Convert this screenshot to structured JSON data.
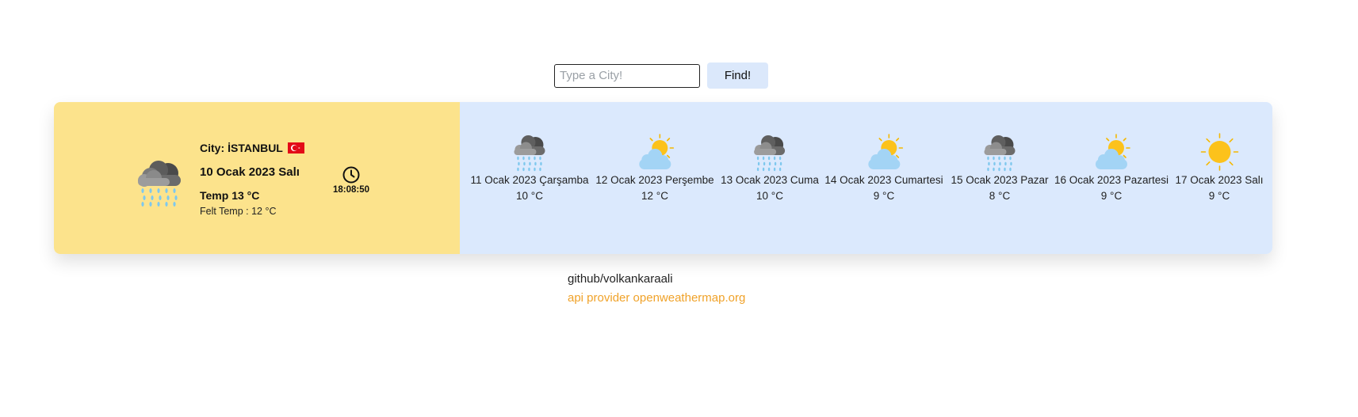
{
  "search": {
    "placeholder": "Type a City!",
    "value": "",
    "button_label": "Find!"
  },
  "current": {
    "city_prefix": "City: ",
    "city": "İSTANBUL",
    "flag": "turkey-flag",
    "date": "10 Ocak 2023 Salı",
    "temp": "Temp 13 °C",
    "felt_temp": "Felt Temp : 12 °C",
    "time": "18:08:50",
    "icon": "rain-cloud-icon"
  },
  "forecast": [
    {
      "date": "11 Ocak 2023 Çarşamba",
      "temp": "10 °C",
      "icon": "rain-cloud-icon"
    },
    {
      "date": "12 Ocak 2023 Perşembe",
      "temp": "12 °C",
      "icon": "partly-cloudy-icon"
    },
    {
      "date": "13 Ocak 2023 Cuma",
      "temp": "10 °C",
      "icon": "rain-cloud-icon"
    },
    {
      "date": "14 Ocak 2023 Cumartesi",
      "temp": "9 °C",
      "icon": "partly-cloudy-icon"
    },
    {
      "date": "15 Ocak 2023 Pazar",
      "temp": "8 °C",
      "icon": "rain-cloud-icon"
    },
    {
      "date": "16 Ocak 2023 Pazartesi",
      "temp": "9 °C",
      "icon": "partly-cloudy-icon"
    },
    {
      "date": "17 Ocak 2023 Salı",
      "temp": "9 °C",
      "icon": "sun-icon"
    }
  ],
  "footer": {
    "github": "github/volkankaraali",
    "api": "api provider openweathermap.org"
  },
  "colors": {
    "current_bg": "#fce38c",
    "forecast_bg": "#dbe9fd",
    "button_bg": "#dbe8fb",
    "link": "#f0a229"
  }
}
